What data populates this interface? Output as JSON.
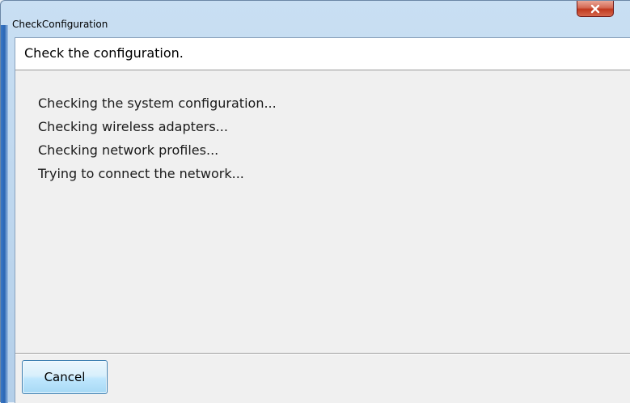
{
  "window": {
    "title": "CheckConfiguration",
    "close_icon": "close-x-icon"
  },
  "header": {
    "text": "Check the configuration."
  },
  "status": {
    "lines": [
      "Checking the system configuration...",
      "Checking wireless adapters...",
      "Checking network profiles...",
      "Trying to connect the network..."
    ]
  },
  "footer": {
    "cancel_label": "Cancel"
  },
  "colors": {
    "title_bar": "#c9dff3",
    "close_button": "#c0391f",
    "client_background": "#f0f0f0",
    "header_background": "#ffffff",
    "button_border": "#3c7fb1"
  }
}
